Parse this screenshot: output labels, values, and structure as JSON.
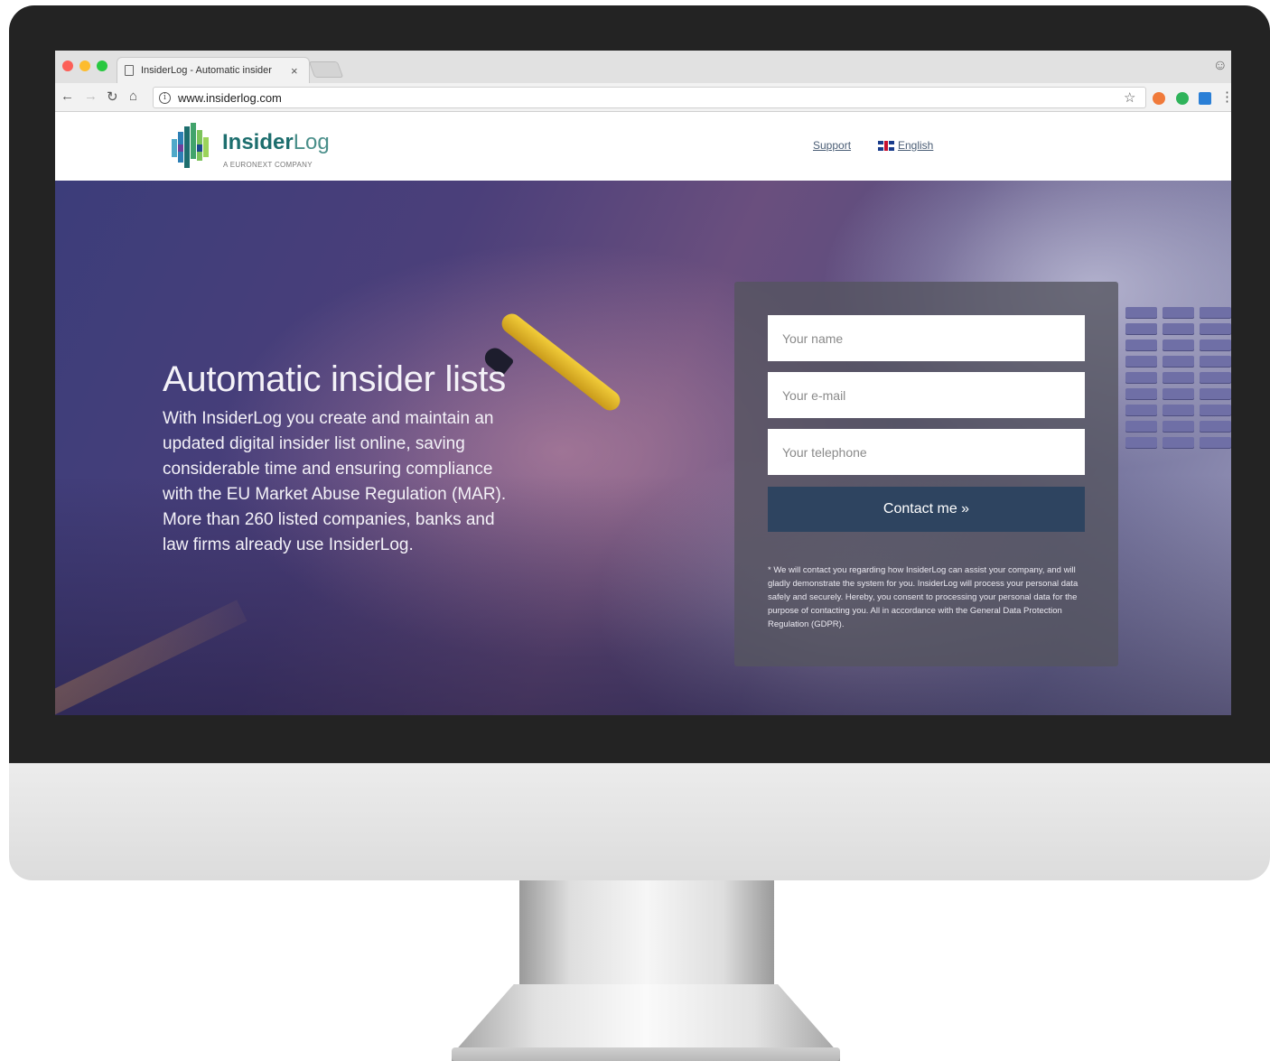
{
  "browser": {
    "tab_title": "InsiderLog - Automatic insider",
    "tab_close": "×",
    "url": "www.insiderlog.com",
    "nav_icons": [
      "back-arrow-icon",
      "forward-arrow-icon",
      "reload-icon",
      "home-icon",
      "info-icon"
    ],
    "toolbar_icons": [
      "star-icon",
      "extension-icon",
      "grammarly-icon",
      "extension-icon",
      "menu-icon"
    ]
  },
  "header": {
    "logo_bold": "Insider",
    "logo_light": "Log",
    "logo_tagline": "A EURONEXT COMPANY",
    "nav": {
      "support": "Support",
      "language": "English"
    }
  },
  "hero": {
    "title": "Automatic insider lists",
    "text": "With InsiderLog you create and maintain an updated digital insider list online, saving considerable time and ensuring compliance with the EU Market Abuse Regulation (MAR). More than 260 listed companies, banks and law firms already use InsiderLog."
  },
  "form": {
    "name_placeholder": "Your name",
    "email_placeholder": "Your e-mail",
    "phone_placeholder": "Your telephone",
    "submit_label": "Contact me »",
    "disclaimer": "* We will contact you regarding how InsiderLog can assist your company, and will gladly demonstrate the system for you. InsiderLog will process your personal data safely and securely. Hereby, you consent to processing your personal data for the purpose of contacting you. All in accordance with the General Data Protection Regulation (GDPR)."
  },
  "colors": {
    "brand": "#1d6e6e",
    "button": "#2e4460",
    "link": "#4a5d75"
  }
}
